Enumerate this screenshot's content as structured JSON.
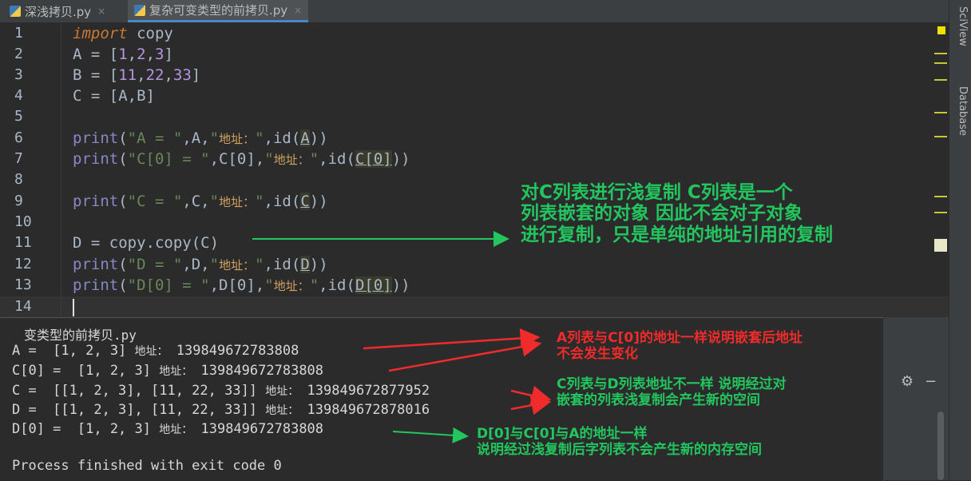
{
  "tabs": [
    {
      "label": "深浅拷贝.py",
      "close": "×"
    },
    {
      "label": "复杂可变类型的前拷贝.py",
      "close": "×"
    }
  ],
  "side_tools": {
    "sciview": "SciView",
    "database": "Database"
  },
  "line_numbers": [
    "1",
    "2",
    "3",
    "4",
    "5",
    "6",
    "7",
    "8",
    "9",
    "10",
    "11",
    "12",
    "13",
    "14"
  ],
  "code": {
    "l1_kw": "import",
    "l1_rest": " copy",
    "l2": "A = [",
    "l2_nums": [
      "1",
      "2",
      "3"
    ],
    "l3": "B = [",
    "l3_nums": [
      "11",
      "22",
      "33"
    ],
    "l4": "C = [A,B]",
    "print": "print",
    "l6_str1": "\"A = \"",
    "l6_mid": ",A,",
    "l6_str2q": "\"",
    "l6_cn": "地址：",
    "l6_end": ",id(",
    "l6_arg": "A",
    "l6_close": "))",
    "l7_str1": "\"C[0] = \"",
    "l7_mid": ",C[0],",
    "l7_cn": "地址：",
    "l7_arg": "C[0]",
    "l7_close": "))",
    "l9_str1": "\"C = \"",
    "l9_mid": ",C,",
    "l9_cn": "地址：",
    "l9_arg": "C",
    "l9_close": "))",
    "l11": "D = copy.copy(C)",
    "l12_str1": "\"D = \"",
    "l12_mid": ",D,",
    "l12_cn": "地址：",
    "l12_arg": "D",
    "l12_close": "))",
    "l13_str1": "\"D[0] = \"",
    "l13_mid": ",D[0],",
    "l13_cn": "地址：",
    "l13_arg": "D[0]",
    "l13_close": "))"
  },
  "console": {
    "header": "变类型的前拷贝.py",
    "rows": [
      {
        "label": "A =  [1, 2, 3]",
        "addr_label": "地址：",
        "addr": "139849672783808"
      },
      {
        "label": "C[0] =  [1, 2, 3]",
        "addr_label": "地址：",
        "addr": "139849672783808"
      },
      {
        "label": "C =  [[1, 2, 3], [11, 22, 33]]",
        "addr_label": "地址：",
        "addr": "139849672877952"
      },
      {
        "label": "D =  [[1, 2, 3], [11, 22, 33]]",
        "addr_label": "地址：",
        "addr": "139849672878016"
      },
      {
        "label": "D[0] =  [1, 2, 3]",
        "addr_label": "地址：",
        "addr": "139849672783808"
      }
    ],
    "footer": "Process finished with exit code 0"
  },
  "annotations": {
    "green_top": [
      "对C列表进行浅复制 C列表是一个",
      "列表嵌套的对象 因此不会对子对象",
      "进行复制，只是单纯的地址引用的复制"
    ],
    "red1": [
      "A列表与C[0]的地址一样说明嵌套后地址",
      "不会发生变化"
    ],
    "green2": [
      "C列表与D列表地址不一样 说明经过对",
      "嵌套的列表浅复制会产生新的空间"
    ],
    "green3": [
      "D[0]与C[0]与A的地址一样",
      "说明经过浅复制后字列表不会产生新的内存空间"
    ]
  },
  "colors": {
    "green_note": "#22c55e",
    "red_note": "#ef2b2b",
    "editor_bg": "#2b2b2b"
  }
}
